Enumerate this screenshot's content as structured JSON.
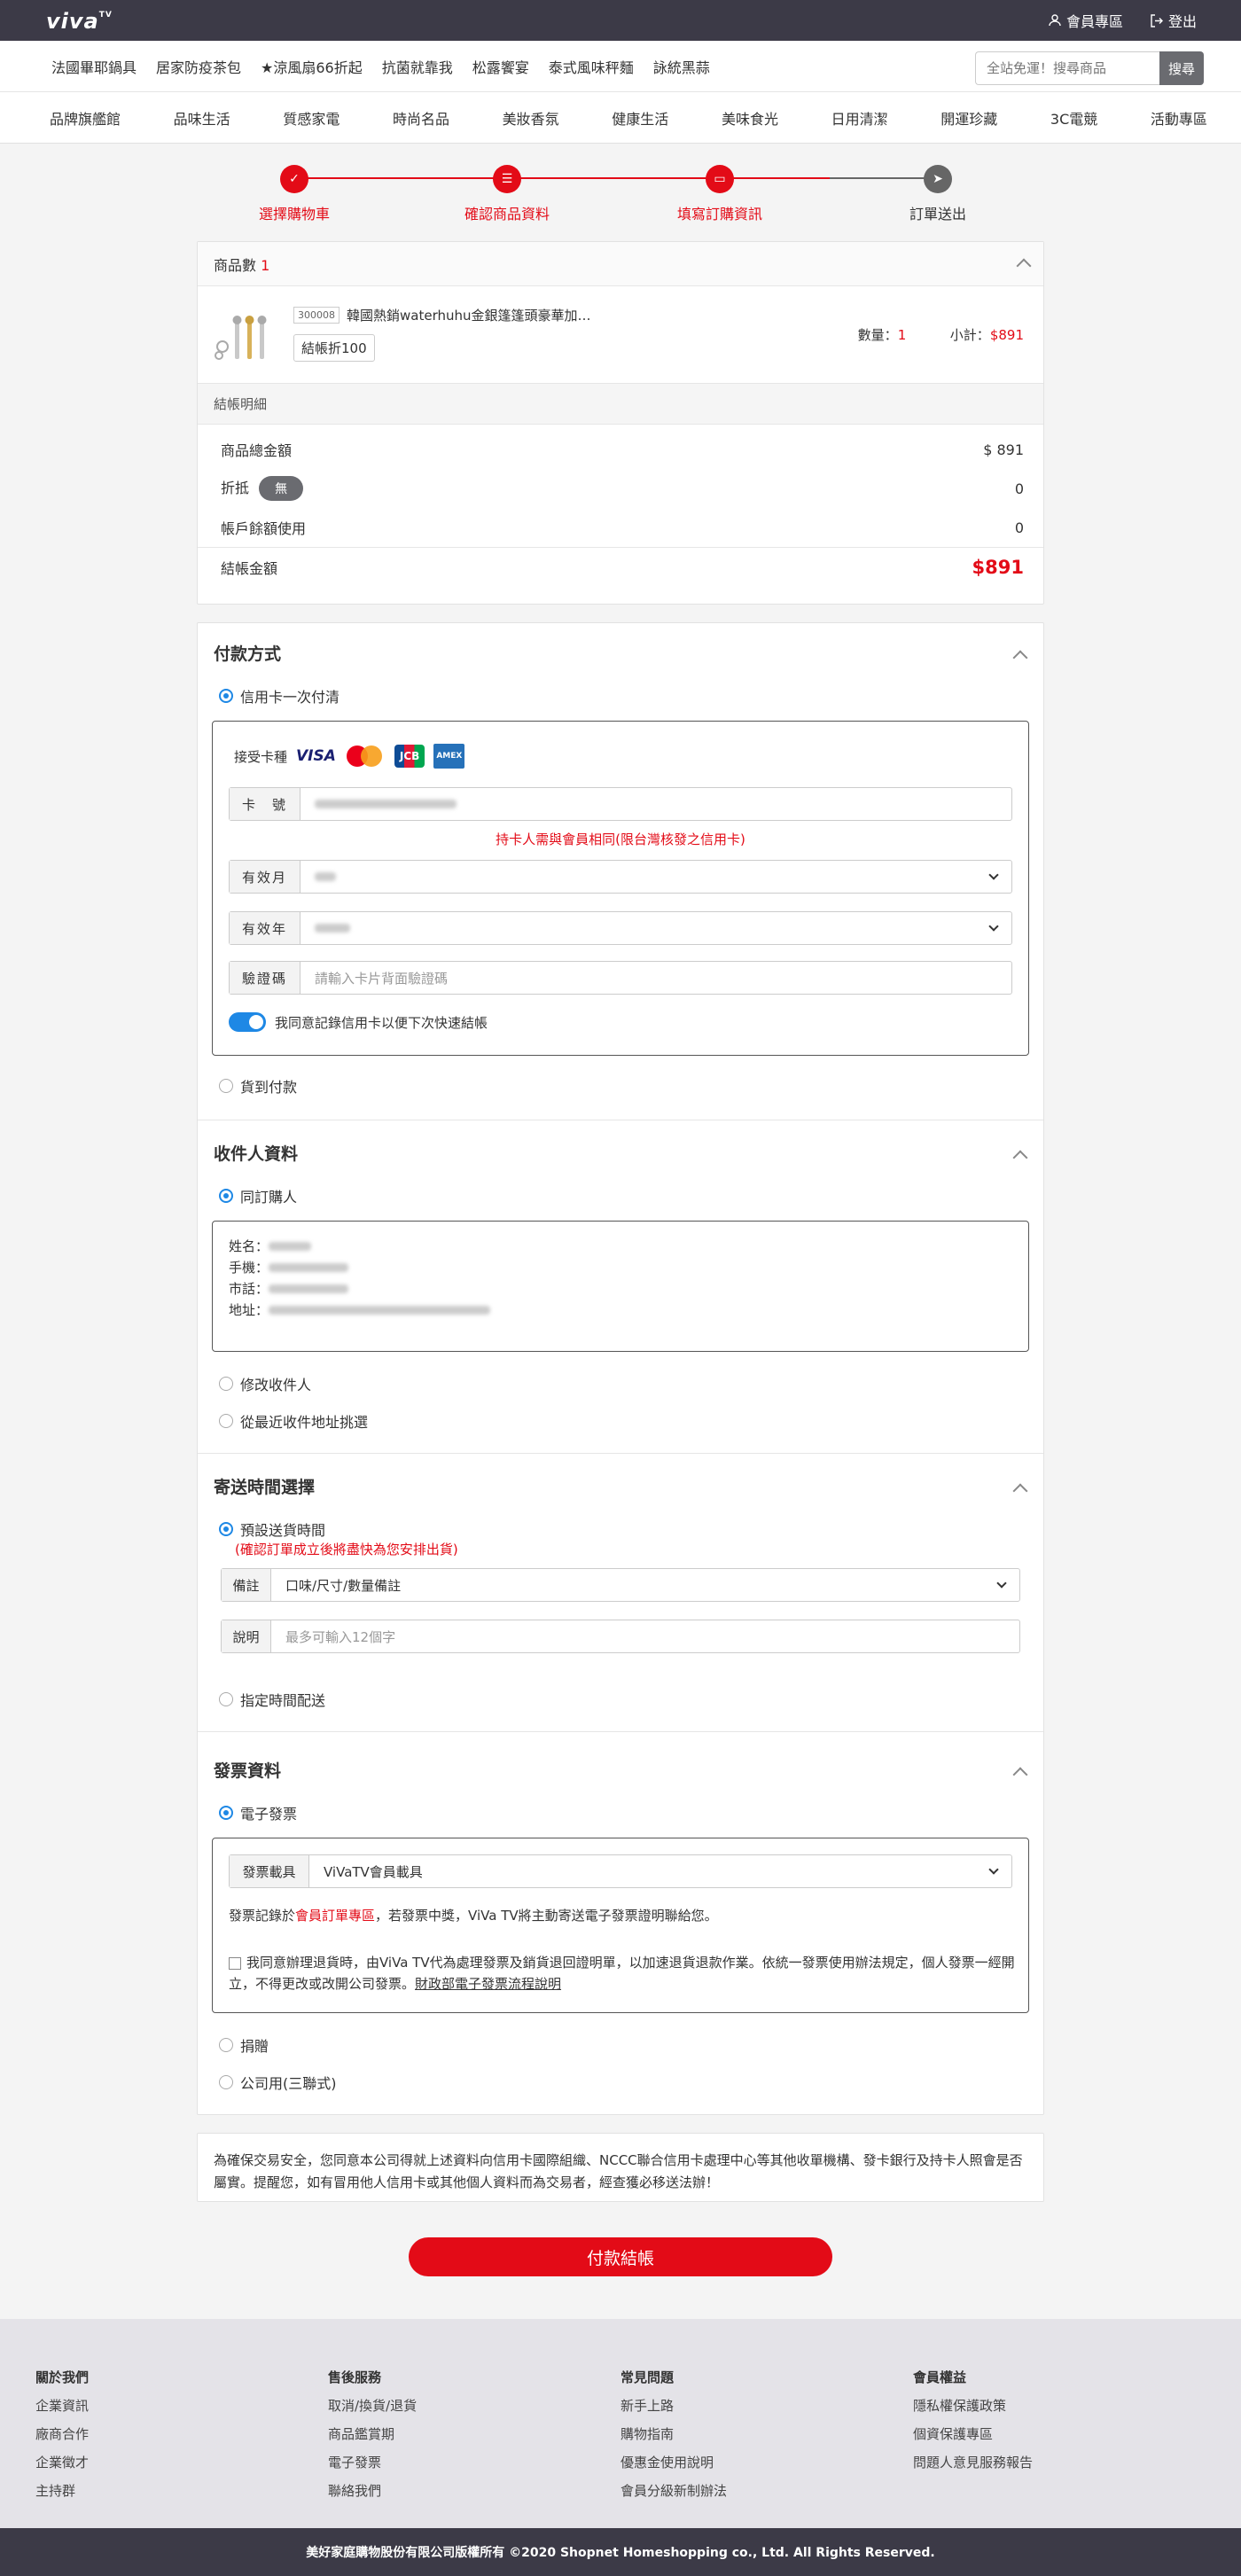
{
  "header": {
    "logo": "viva",
    "logo_tv": "TV",
    "member_link": "會員專區",
    "logout_link": "登出"
  },
  "quicklinks": [
    "法國畢耶鍋具",
    "居家防疫茶包",
    "★涼風扇66折起",
    "抗菌就靠我",
    "松露饗宴",
    "泰式風味秤麵",
    "詠統黑蒜"
  ],
  "search": {
    "placeholder": "全站免運！搜尋商品",
    "button": "搜尋"
  },
  "categories": [
    "品牌旗艦館",
    "品味生活",
    "質感家電",
    "時尚名品",
    "美妝香氛",
    "健康生活",
    "美味食光",
    "日用清潔",
    "開運珍藏",
    "3C電競",
    "活動專區"
  ],
  "steps": [
    {
      "label": "選擇購物車",
      "done": true
    },
    {
      "label": "確認商品資料",
      "done": true
    },
    {
      "label": "填寫訂購資訊",
      "done": true
    },
    {
      "label": "訂單送出",
      "done": false
    }
  ],
  "colors": {
    "accent": "#e30b17",
    "blue": "#1e88e5",
    "dark": "#3c3a47"
  },
  "cart": {
    "count_label": "商品數",
    "count": "1",
    "product": {
      "code": "300008",
      "name": "韓國熱銷waterhuhu金銀篷篷頭豪華加…",
      "tag": "結帳折100",
      "qty_label": "數量：",
      "qty": "1",
      "subtotal_label": "小計：",
      "subtotal": "$891"
    },
    "summary_title": "結帳明細",
    "summary": {
      "total_label": "商品總金額",
      "total": "$ 891",
      "discount_label": "折抵",
      "discount_badge": "無",
      "discount": "0",
      "balance_label": "帳戶餘額使用",
      "balance": "0",
      "pay_label": "結帳金額",
      "pay": "$891"
    }
  },
  "payment": {
    "title": "付款方式",
    "option1": "信用卡一次付清",
    "cards_label": "接受卡種",
    "card_logos": [
      "VISA",
      "MasterCard",
      "JCB",
      "AMEX"
    ],
    "card_no_label": "卡　號",
    "card_note": "持卡人需與會員相同(限台灣核發之信用卡)",
    "month_label": "有效月",
    "year_label": "有效年",
    "cvv_label": "驗證碼",
    "cvv_placeholder": "請輸入卡片背面驗證碼",
    "remember": "我同意記錄信用卡以便下次快速結帳",
    "option2": "貨到付款"
  },
  "receiver": {
    "title": "收件人資料",
    "option1": "同訂購人",
    "name_label": "姓名：",
    "mobile_label": "手機：",
    "phone_label": "市話：",
    "address_label": "地址：",
    "option2": "修改收件人",
    "option3": "從最近收件地址挑選"
  },
  "delivery": {
    "title": "寄送時間選擇",
    "option1": "預設送貨時間",
    "note": "(確認訂單成立後將盡快為您安排出貨)",
    "remark_label": "備註",
    "remark_value": "口味/尺寸/數量備註",
    "desc_label": "說明",
    "desc_placeholder": "最多可輸入12個字",
    "option2": "指定時間配送"
  },
  "invoice": {
    "title": "發票資料",
    "option1": "電子發票",
    "carrier_label": "發票載具",
    "carrier_value": "ViVaTV會員載具",
    "record_pre": "發票記錄於",
    "record_link": "會員訂單專區",
    "record_post": "，若發票中獎，ViVa TV將主動寄送電子發票證明聯給您。",
    "agree_text": "我同意辦理退貨時，由ViVa TV代為處理發票及銷貨退回證明單，以加速退貨退款作業。依統一發票使用辦法規定，個人發票一經開立，不得更改或改開公司發票。",
    "agree_link": "財政部電子發票流程說明",
    "option2": "捐贈",
    "option3": "公司用(三聯式)"
  },
  "notice": "為確保交易安全，您同意本公司得就上述資料向信用卡國際組織、NCCC聯合信用卡處理中心等其他收單機構、發卡銀行及持卡人照會是否屬實。提醒您，如有冒用他人信用卡或其他個人資料而為交易者，經查獲必移送法辦！",
  "pay_button": "付款結帳",
  "footer": {
    "cols": [
      {
        "title": "關於我們",
        "items": [
          "企業資訊",
          "廠商合作",
          "企業徵才",
          "主持群"
        ]
      },
      {
        "title": "售後服務",
        "items": [
          "取消/換貨/退貨",
          "商品鑑賞期",
          "電子發票",
          "聯絡我們"
        ]
      },
      {
        "title": "常見問題",
        "items": [
          "新手上路",
          "購物指南",
          "優惠金使用說明",
          "會員分級新制辦法"
        ]
      },
      {
        "title": "會員權益",
        "items": [
          "隱私權保護政策",
          "個資保護專區",
          "問題人意見服務報告"
        ]
      }
    ],
    "copyright": "美好家庭購物股份有限公司版權所有 ©2020 Shopnet Homeshopping co., Ltd. All Rights Reserved."
  }
}
